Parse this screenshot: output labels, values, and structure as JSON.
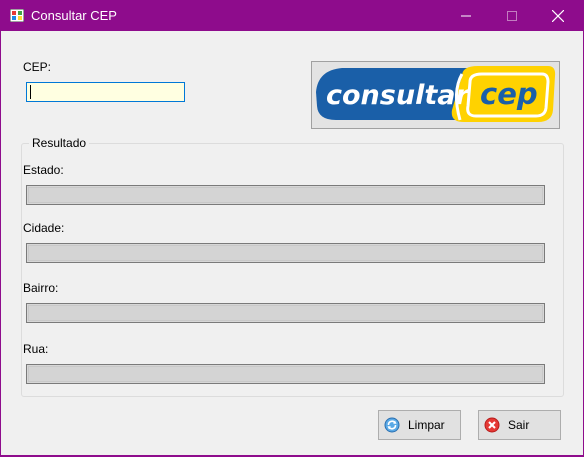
{
  "window": {
    "title": "Consultar CEP",
    "accent_color": "#8e0c8c",
    "controls": [
      "minimize-icon",
      "maximize-icon",
      "close-icon"
    ]
  },
  "cep": {
    "label": "CEP:",
    "value": ""
  },
  "logo": {
    "text_left": "consultar",
    "text_right": "cep",
    "colors": {
      "blue": "#1a5fa8",
      "yellow": "#ffd200"
    }
  },
  "result": {
    "group_title": "Resultado",
    "fields": [
      {
        "label": "Estado:",
        "value": ""
      },
      {
        "label": "Cidade:",
        "value": ""
      },
      {
        "label": "Bairro:",
        "value": ""
      },
      {
        "label": "Rua:",
        "value": ""
      }
    ]
  },
  "buttons": {
    "clear": {
      "label": "Limpar",
      "icon": "refresh-icon"
    },
    "exit": {
      "label": "Sair",
      "icon": "close-circle-icon"
    }
  }
}
